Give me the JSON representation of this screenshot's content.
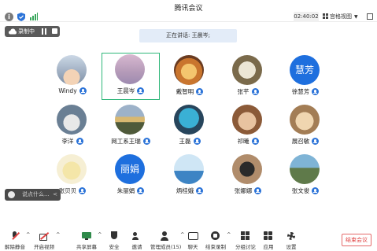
{
  "window": {
    "title": "腾讯会议",
    "timer": "02:40:02",
    "view_label": "宫格视图"
  },
  "recording": {
    "label": "录制中"
  },
  "speaking_banner": "正在讲话: 王晨岑;",
  "participants": [
    {
      "name": "Windy",
      "avatar": "photo"
    },
    {
      "name": "王晨岑",
      "avatar": "photo",
      "active": true
    },
    {
      "name": "戴智明",
      "avatar": "photo"
    },
    {
      "name": "张芊",
      "avatar": "photo"
    },
    {
      "name": "徐慧芳",
      "avatar": "text",
      "avatar_text": "慧芳",
      "avatar_color": "#1e6fde"
    },
    {
      "name": "李洋",
      "avatar": "photo"
    },
    {
      "name": "网工系王瑞",
      "avatar": "photo"
    },
    {
      "name": "王磊",
      "avatar": "photo"
    },
    {
      "name": "祁曦",
      "avatar": "photo"
    },
    {
      "name": "展召敏",
      "avatar": "photo"
    },
    {
      "name": "张贝贝",
      "avatar": "photo"
    },
    {
      "name": "朱丽娟",
      "avatar": "text",
      "avatar_text": "丽娟",
      "avatar_color": "#1e6fde"
    },
    {
      "name": "炳桂娥",
      "avatar": "photo"
    },
    {
      "name": "张娜娜",
      "avatar": "photo"
    },
    {
      "name": "张文俊",
      "avatar": "photo"
    }
  ],
  "chat": {
    "placeholder": "说点什么..."
  },
  "toolbar": {
    "unmute": "解除静音",
    "start_video": "开启视频",
    "share_screen": "共享屏幕",
    "security": "安全",
    "invite": "邀请",
    "manage_members": "管理成员(15)",
    "chat": "聊天",
    "end_recording": "结束录制",
    "breakout": "分组讨论",
    "apps": "应用",
    "settings": "设置",
    "end_meeting": "结束会议"
  },
  "colors": {
    "accent_blue": "#1e6fde",
    "active_border": "#2fb77a",
    "end_red": "#e04545"
  }
}
